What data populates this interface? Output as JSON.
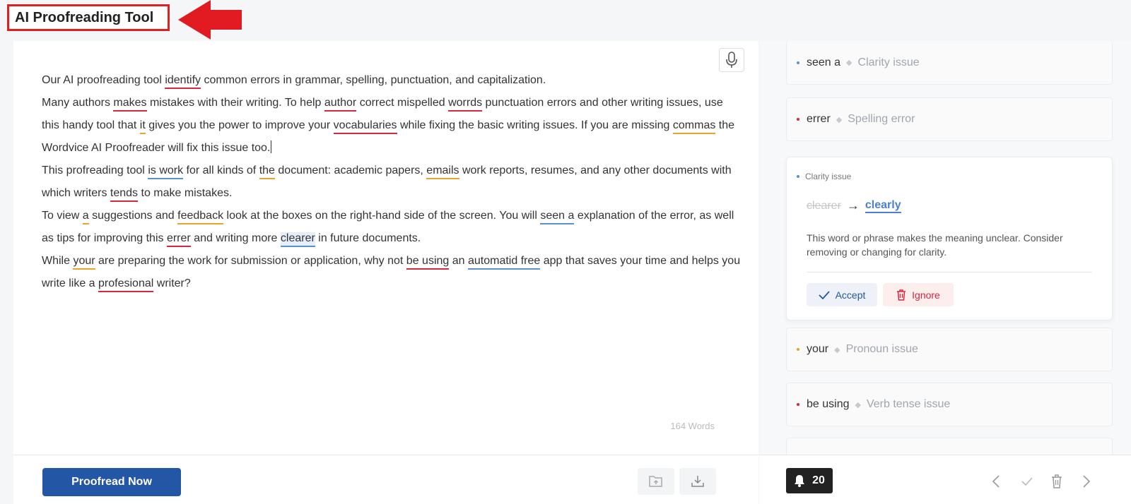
{
  "app": {
    "title": "AI Proofreading Tool"
  },
  "editor": {
    "paragraphs": [
      [
        {
          "t": "Our AI proofreading tool "
        },
        {
          "t": "identify",
          "u": "red"
        },
        {
          "t": " common errors in grammar, spelling, punctuation, and capitalization."
        }
      ],
      [
        {
          "t": "Many authors "
        },
        {
          "t": "makes",
          "u": "red"
        },
        {
          "t": " mistakes with their writing. To help "
        },
        {
          "t": "author",
          "u": "red"
        },
        {
          "t": " correct mispelled "
        },
        {
          "t": "worrds",
          "u": "red"
        },
        {
          "t": " punctuation errors and other writing issues, use this handy tool that "
        },
        {
          "t": "it",
          "u": "orange"
        },
        {
          "t": " gives you the power to improve your "
        },
        {
          "t": "vocabularies",
          "u": "red"
        },
        {
          "t": " while fixing the basic writing issues. If you are missing "
        },
        {
          "t": "commas",
          "u": "orange"
        },
        {
          "t": " the Wordvice AI Proofreader will fix this issue too."
        },
        {
          "caret": true
        }
      ],
      [
        {
          "t": "This profreading tool "
        },
        {
          "t": "is work",
          "u": "blue"
        },
        {
          "t": " for all kinds of "
        },
        {
          "t": "the",
          "u": "orange"
        },
        {
          "t": " document: academic papers, "
        },
        {
          "t": "emails",
          "u": "orange"
        },
        {
          "t": " work reports, resumes, and any other documents with which writers "
        },
        {
          "t": "tends",
          "u": "red"
        },
        {
          "t": " to make mistakes."
        }
      ],
      [
        {
          "t": "To view "
        },
        {
          "t": "a",
          "u": "orange"
        },
        {
          "t": " suggestions and "
        },
        {
          "t": "feedback",
          "u": "orange"
        },
        {
          "t": " look at the boxes on the right-hand side of the screen. You will "
        },
        {
          "t": "seen a",
          "u": "blue"
        },
        {
          "t": " explanation of the error, as well as tips for improving this "
        },
        {
          "t": "errer",
          "u": "red"
        },
        {
          "t": " and writing more "
        },
        {
          "t": "clearer",
          "u": "blue-hl"
        },
        {
          "t": " in future documents."
        }
      ],
      [
        {
          "t": "While "
        },
        {
          "t": "your",
          "u": "orange"
        },
        {
          "t": " are preparing the work for submission or application, why not "
        },
        {
          "t": "be using",
          "u": "red"
        },
        {
          "t": " an "
        },
        {
          "t": "automatid free",
          "u": "blue"
        },
        {
          "t": " app that saves your time and helps you write like a "
        },
        {
          "t": "profesional",
          "u": "red"
        },
        {
          "t": " writer?"
        }
      ]
    ],
    "word_count": "164 Words",
    "proofread_label": "Proofread Now"
  },
  "issues": {
    "list_top": [
      {
        "word": "seen a",
        "type": "Clarity issue",
        "color": "#5b8fd0"
      },
      {
        "word": "errer",
        "type": "Spelling error",
        "color": "#d7263d"
      }
    ],
    "expanded": {
      "type": "Clarity issue",
      "color": "#5b8fd0",
      "old": "clearer",
      "arrow": "→",
      "new": "clearly",
      "description": "This word or phrase makes the meaning unclear. Consider removing or changing for clarity.",
      "accept_label": "Accept",
      "ignore_label": "Ignore"
    },
    "list_bottom": [
      {
        "word": "your",
        "type": "Pronoun issue",
        "color": "#e8a32c"
      },
      {
        "word": "be using",
        "type": "Verb tense issue",
        "color": "#d7263d"
      }
    ],
    "count": "20"
  },
  "colors": {
    "accent": "#2456a6",
    "error_red": "#d7263d",
    "warning_orange": "#e8a32c",
    "clarity_blue": "#5b8fd0",
    "annotation_red": "#e02020"
  }
}
